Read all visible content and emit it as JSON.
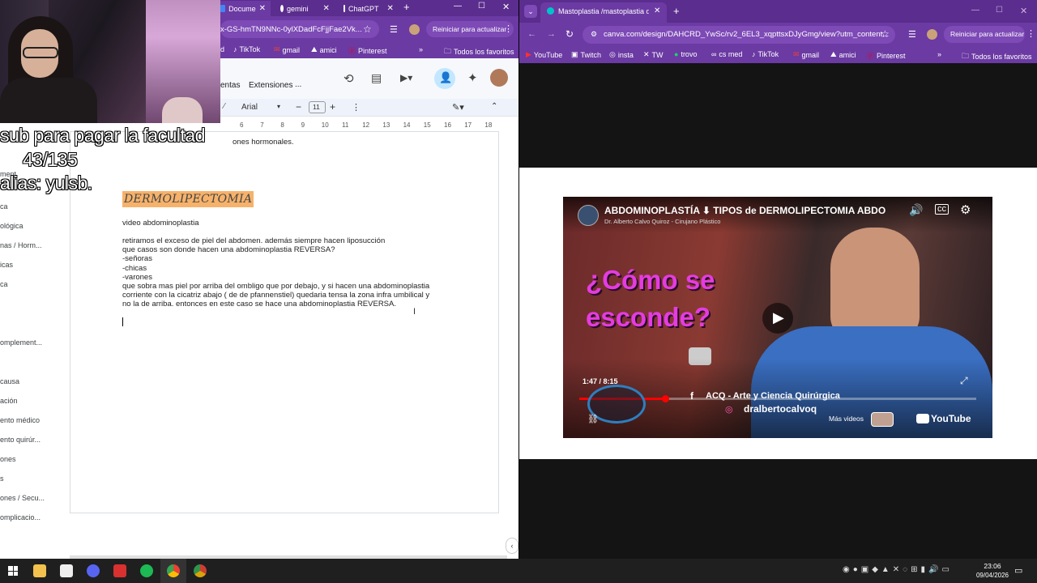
{
  "left_browser": {
    "tabs": [
      {
        "label": "Docume"
      },
      {
        "label": "gemini"
      },
      {
        "label": "ChatGPT"
      }
    ],
    "url": "x-GS-hmTN9NNc-0ylXDadFcFjjFae2Vk...",
    "update_label": "Reiniciar para actualizar",
    "bookmarks": [
      {
        "label": "d"
      },
      {
        "label": "TikTok"
      },
      {
        "label": "gmail"
      },
      {
        "label": "amici"
      },
      {
        "label": "Pinterest"
      }
    ],
    "all_bookmarks": "Todos los favoritos"
  },
  "docs": {
    "menu_partial": "entas",
    "menu_extensions": "Extensiones",
    "menu_more": "...",
    "font": "Arial",
    "font_size": "11",
    "ruler_numbers": [
      "6",
      "7",
      "8",
      "9",
      "10",
      "11",
      "12",
      "13",
      "14",
      "15",
      "16",
      "17",
      "18"
    ],
    "line_top": "ones hormonales.",
    "heading": "DERMOLIPECTOMIA",
    "lines": [
      "video abdominoplastia",
      "retiramos el exceso de piel del abdomen. además siempre hacen liposucción",
      "que casos son donde hacen una abdominoplastia REVERSA?",
      "-señoras",
      "-chicas",
      "-varones",
      "    que sobra mas piel por arriba del ombligo que por debajo, y si hacen una abdominoplastia",
      "corriente con la cicatriz abajo ( de de pfannenstiel) quedaria tensa la zona infra umbilical y",
      "no la de arriba. entonces en este caso se hace una abdominoplastia REVERSA."
    ],
    "outline": [
      "ca",
      "ológica",
      "nas / Horm...",
      "icas",
      "ca",
      "omplement...",
      "causa",
      "ación",
      "ento médico",
      "ento quirúr...",
      "ones",
      "s",
      "ones / Secu...",
      "omplicacio..."
    ],
    "outline_top": "ment"
  },
  "overlay": {
    "line1": "sub para pagar la facultad",
    "line2": "43/135",
    "line3": "alias: yulsb."
  },
  "right_browser": {
    "tab_title": "Mastoplastia /mastoplastia de",
    "url": "canva.com/design/DAHCRD_YwSc/rv2_6EL3_xqpttsxDJyGmg/view?utm_content...",
    "update_label": "Reiniciar para actualizar",
    "bookmarks": [
      {
        "label": "YouTube"
      },
      {
        "label": "Twitch"
      },
      {
        "label": "insta"
      },
      {
        "label": "TW"
      },
      {
        "label": "trovo"
      },
      {
        "label": "cs med"
      },
      {
        "label": "TikTok"
      },
      {
        "label": "gmail"
      },
      {
        "label": "amici"
      },
      {
        "label": "Pinterest"
      }
    ],
    "all_bookmarks": "Todos los favoritos"
  },
  "video": {
    "title": "ABDOMINOPLASTÍA ⬇ TIPOS de DERMOLIPECTOMIA ABDO",
    "channel": "Dr. Alberto Calvo Quiroz - Cirujano Plástico",
    "overlay_q1": "¿Cómo se",
    "overlay_q2": "esconde?",
    "time": "1:47 / 8:15",
    "progress": 0.216,
    "fb_text": "ACQ - Arte y Ciencia Quirúrgica",
    "ig_text": "dralbertocalvoq",
    "more_videos": "Más videos",
    "youtube": "YouTube"
  },
  "taskbar": {
    "time": "23:06",
    "date": "09/04/2026"
  },
  "colors": {
    "browser_purple": "#5b2d8e",
    "heading_highlight": "#f6b26b"
  }
}
